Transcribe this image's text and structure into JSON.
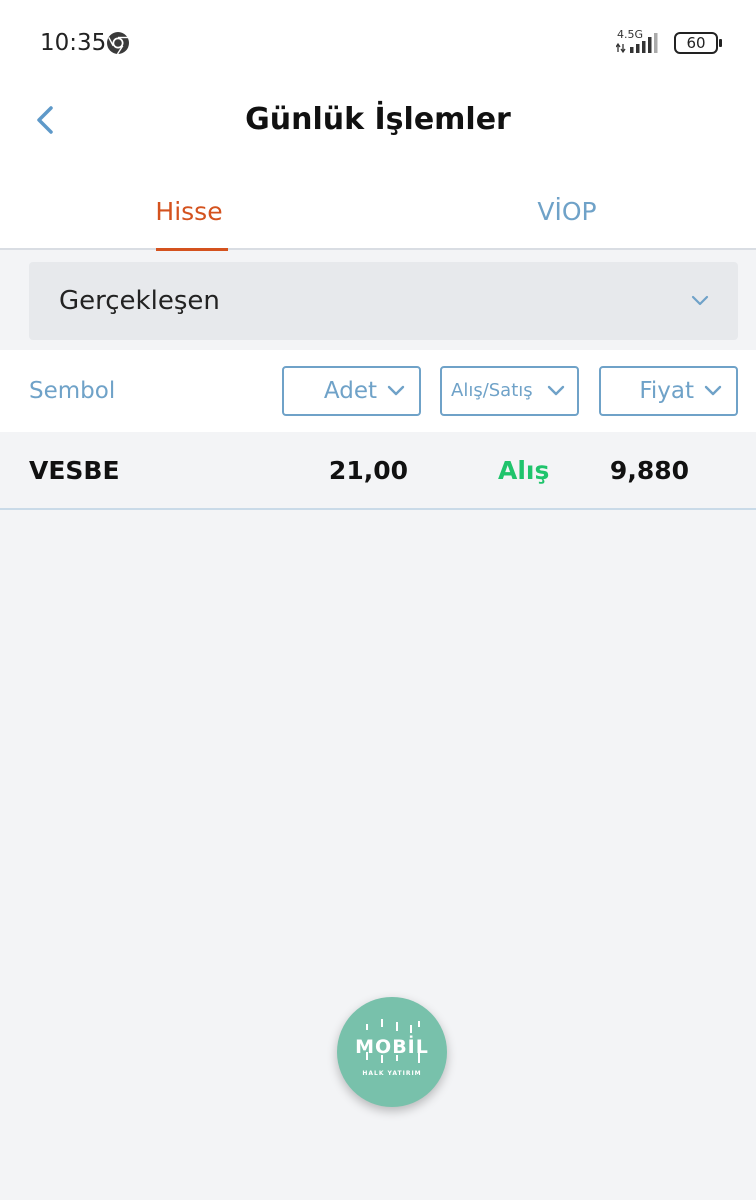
{
  "status_bar": {
    "time": "10:35",
    "network": "4.5G",
    "battery": "60"
  },
  "header": {
    "title": "Günlük İşlemler"
  },
  "tabs": [
    {
      "label": "Hisse",
      "active": true
    },
    {
      "label": "VİOP",
      "active": false
    }
  ],
  "filter": {
    "selected": "Gerçekleşen"
  },
  "columns": {
    "symbol": "Sembol",
    "quantity": "Adet",
    "side": "Alış/Satış",
    "price": "Fiyat"
  },
  "rows": [
    {
      "symbol": "VESBE",
      "quantity": "21,00",
      "side": "Alış",
      "price": "9,880"
    }
  ],
  "fab": {
    "logo_text": "MOBİL",
    "brand": "HALK YATIRIM"
  },
  "colors": {
    "accent": "#d4521e",
    "secondary": "#6fa2c8",
    "buy": "#1fc46c",
    "fab": "#78c1ab"
  }
}
